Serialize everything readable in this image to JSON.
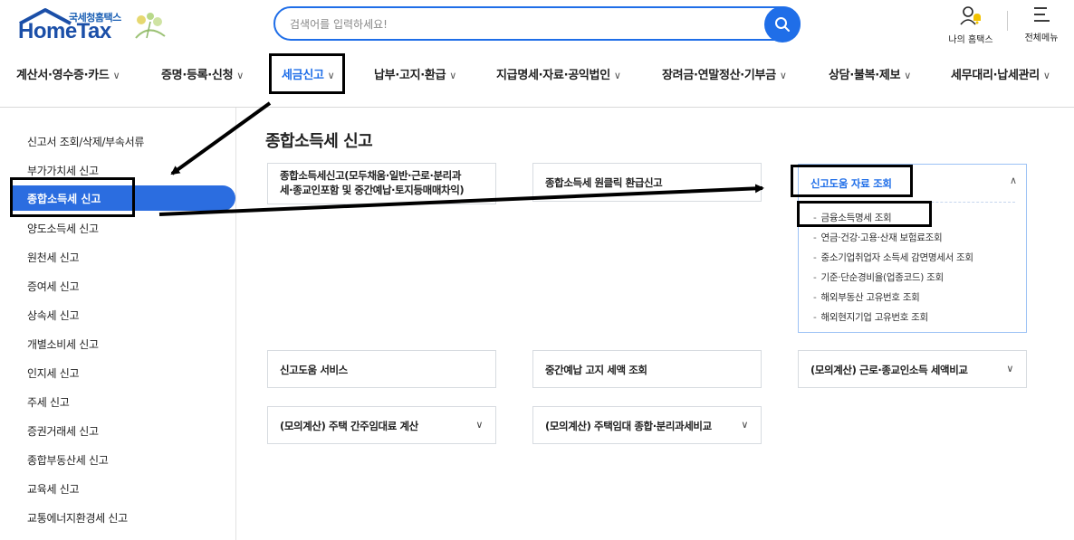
{
  "header": {
    "logo_small": "국세청홈택스",
    "logo_big": "HomeTax",
    "search_placeholder": "검색어를 입력하세요!",
    "my_hometax_label": "나의 홈택스",
    "all_menu_label": "전체메뉴"
  },
  "gnb": {
    "items": [
      {
        "label": "계산서·영수증·카드"
      },
      {
        "label": "증명·등록·신청"
      },
      {
        "label": "세금신고"
      },
      {
        "label": "납부·고지·환급"
      },
      {
        "label": "지급명세·자료·공익법인"
      },
      {
        "label": "장려금·연말정산·기부금"
      },
      {
        "label": "상담·불복·제보"
      },
      {
        "label": "세무대리·납세관리"
      }
    ],
    "active_index": 2
  },
  "sidebar": {
    "items": [
      {
        "label": "신고서 조회/삭제/부속서류"
      },
      {
        "label": "부가가치세 신고"
      },
      {
        "label": "종합소득세 신고"
      },
      {
        "label": "양도소득세 신고"
      },
      {
        "label": "원천세 신고"
      },
      {
        "label": "증여세 신고"
      },
      {
        "label": "상속세 신고"
      },
      {
        "label": "개별소비세 신고"
      },
      {
        "label": "인지세 신고"
      },
      {
        "label": "주세 신고"
      },
      {
        "label": "증권거래세 신고"
      },
      {
        "label": "종합부동산세 신고"
      },
      {
        "label": "교육세 신고"
      },
      {
        "label": "교통에너지환경세 신고"
      }
    ],
    "active_index": 2
  },
  "main": {
    "title": "종합소득세 신고",
    "cards": {
      "c1_line1": "종합소득세신고(모두채움·일반·근로·분리과",
      "c1_line2": "세·종교인포함 및 중간예납·토지등매매차익)",
      "c2": "종합소득세 원클릭 환급신고",
      "c4": "신고도움 서비스",
      "c5": "중간예납 고지 세액 조회",
      "c6": "(모의계산) 근로·종교인소득 세액비교",
      "c7": "(모의계산) 주택 간주임대료 계산",
      "c8": "(모의계산) 주택임대 종합·분리과세비교"
    },
    "open_card": {
      "title": "신고도움 자료 조회",
      "subitems": [
        {
          "label": "금융소득명세 조회"
        },
        {
          "label": "연금·건강·고용·산재 보험료조회"
        },
        {
          "label": "중소기업취업자 소득세 감면명세서 조회"
        },
        {
          "label": "기준·단순경비율(업종코드) 조회"
        },
        {
          "label": "해외부동산 고유번호 조회"
        },
        {
          "label": "해외현지기업 고유번호 조회"
        }
      ]
    }
  },
  "icons": {
    "search": "search-icon",
    "user_bell": "user-bell-icon",
    "menu": "hamburger-menu-icon",
    "chevron": "chevron-down-icon",
    "chevron_up": "chevron-up-icon"
  },
  "colors": {
    "accent": "#1f6ee8",
    "active_bg": "#2b6de0",
    "logo": "#1b4fa8",
    "annotation": "#000000"
  }
}
